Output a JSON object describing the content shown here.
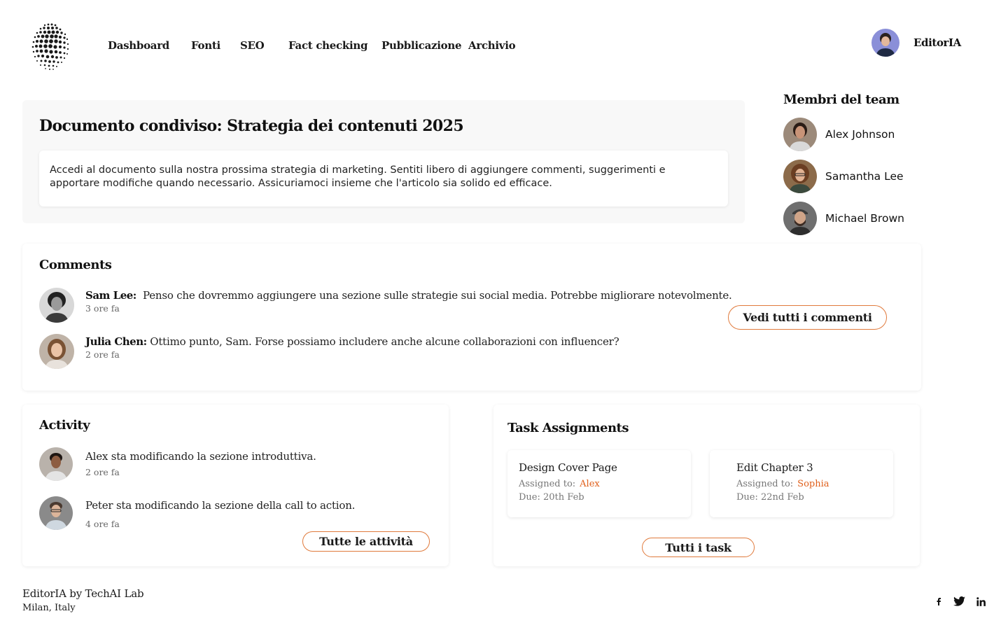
{
  "header": {
    "nav": [
      {
        "label": "Dashboard"
      },
      {
        "label": "Fonti"
      },
      {
        "label": "SEO"
      },
      {
        "label": "Fact checking"
      },
      {
        "label": "Pubblicazione"
      },
      {
        "label": "Archivio"
      }
    ],
    "user_name": "EditorIA"
  },
  "document": {
    "title": "Documento condiviso: Strategia dei contenuti 2025",
    "description": "Accedi al documento sulla nostra prossima strategia di marketing. Sentiti libero di aggiungere commenti, suggerimenti e apportare modifiche quando necessario. Assicuriamoci insieme che l'articolo sia solido ed efficace."
  },
  "team": {
    "title": "Membri del team",
    "members": [
      {
        "name": "Alex Johnson"
      },
      {
        "name": "Samantha Lee"
      },
      {
        "name": "Michael Brown"
      }
    ]
  },
  "comments": {
    "title": "Comments",
    "items": [
      {
        "author": "Sam Lee:",
        "text": "Penso che dovremmo aggiungere una sezione sulle strategie sui social media. Potrebbe migliorare notevolmente.",
        "time": "3 ore fa"
      },
      {
        "author": "Julia Chen:",
        "text": "Ottimo punto, Sam. Forse possiamo includere anche alcune collaborazioni con influencer?",
        "time": "2 ore fa"
      }
    ],
    "view_all_label": "Vedi tutti i commenti"
  },
  "activity": {
    "title": "Activity",
    "items": [
      {
        "text": "Alex sta modificando la sezione introduttiva.",
        "time": "2 ore fa"
      },
      {
        "text": "Peter sta modificando la sezione della call to action.",
        "time": "4 ore fa"
      }
    ],
    "all_label": "Tutte le attività"
  },
  "tasks": {
    "title": "Task Assignments",
    "assigned_label": "Assigned to:",
    "items": [
      {
        "title": "Design Cover Page",
        "assignee": "Alex",
        "due": "Due: 20th Feb"
      },
      {
        "title": "Edit Chapter 3",
        "assignee": "Sophia",
        "due": "Due: 22nd Feb"
      }
    ],
    "all_label": "Tutti i task"
  },
  "footer": {
    "brand": "EditorIA by TechAI Lab",
    "location": "Milan, Italy",
    "social": [
      "facebook-icon",
      "twitter-icon",
      "linkedin-icon"
    ]
  },
  "colors": {
    "accent": "#e07a3c",
    "assignee": "#e0601c",
    "doc_bg": "#f8f8f8"
  }
}
